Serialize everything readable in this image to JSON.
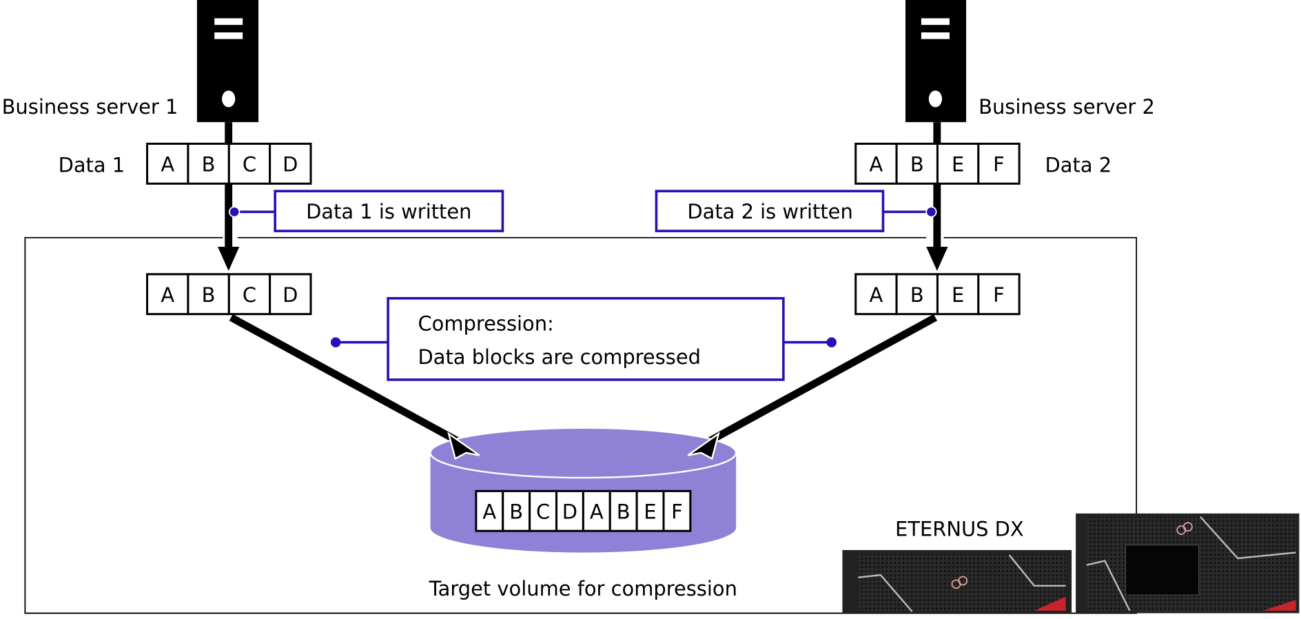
{
  "servers": [
    {
      "label": "Business server 1",
      "data_label": "Data 1",
      "blocks": [
        "A",
        "B",
        "C",
        "D"
      ],
      "callout": "Data 1 is written",
      "written_blocks": [
        "A",
        "B",
        "C",
        "D"
      ]
    },
    {
      "label": "Business server 2",
      "data_label": "Data 2",
      "blocks": [
        "A",
        "B",
        "E",
        "F"
      ],
      "callout": "Data 2 is written",
      "written_blocks": [
        "A",
        "B",
        "E",
        "F"
      ]
    }
  ],
  "compression": {
    "line1": "Compression:",
    "line2": "Data blocks are compressed"
  },
  "volume": {
    "label": "Target volume for compression",
    "blocks": [
      "A",
      "B",
      "C",
      "D",
      "A",
      "B",
      "E",
      "F"
    ]
  },
  "storage": {
    "label": "ETERNUS DX"
  },
  "colors": {
    "callout": "#2a10b4",
    "volume": "#8f82d6",
    "device_accent": "#c8242b"
  }
}
